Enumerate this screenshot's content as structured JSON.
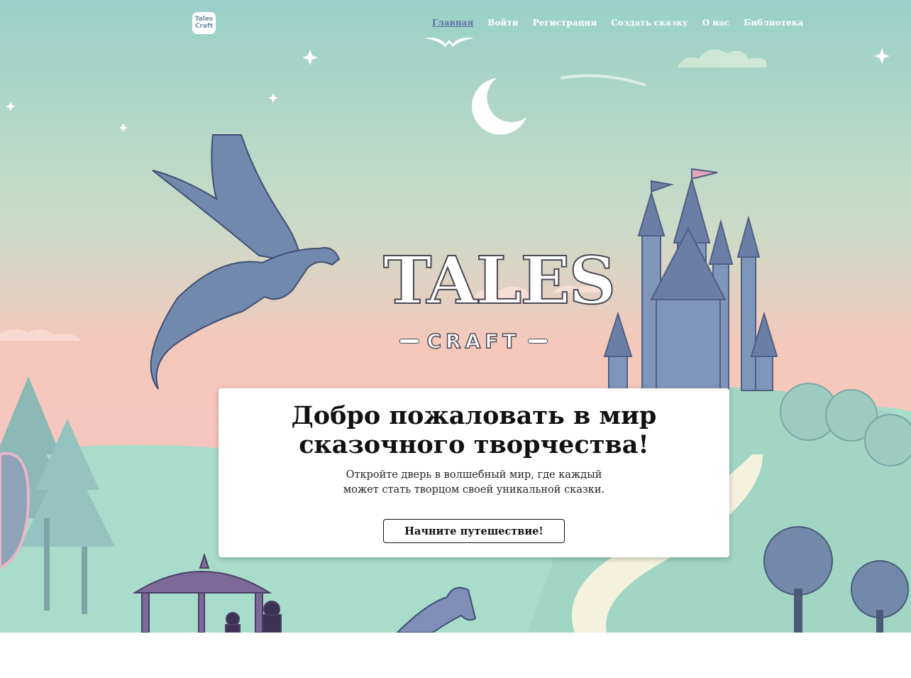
{
  "nav": {
    "logo_alt": "Tales Craft",
    "logo_line1": "Tales",
    "logo_line2": "Craft",
    "items": [
      {
        "label": "Главная",
        "active": true
      },
      {
        "label": "Войти"
      },
      {
        "label": "Регистрация"
      },
      {
        "label": "Создать сказку"
      },
      {
        "label": "О нас"
      },
      {
        "label": "Библиотека"
      }
    ]
  },
  "hero": {
    "logo_title": "TALES",
    "logo_subtitle": "CRAFT",
    "colors": {
      "sky_top": "#9ed2c9",
      "sky_bottom": "#f7c6bd",
      "hill": "#a9dcc9",
      "castle": "#7a90b6",
      "dragon": "#6f86a8"
    }
  },
  "card": {
    "title": "Добро пожаловать в мир сказочного творчества!",
    "description": "Откройте дверь в волшебный мир, где каждый может стать творцом своей уникальной сказки.",
    "cta_label": "Начните путешествие!"
  }
}
